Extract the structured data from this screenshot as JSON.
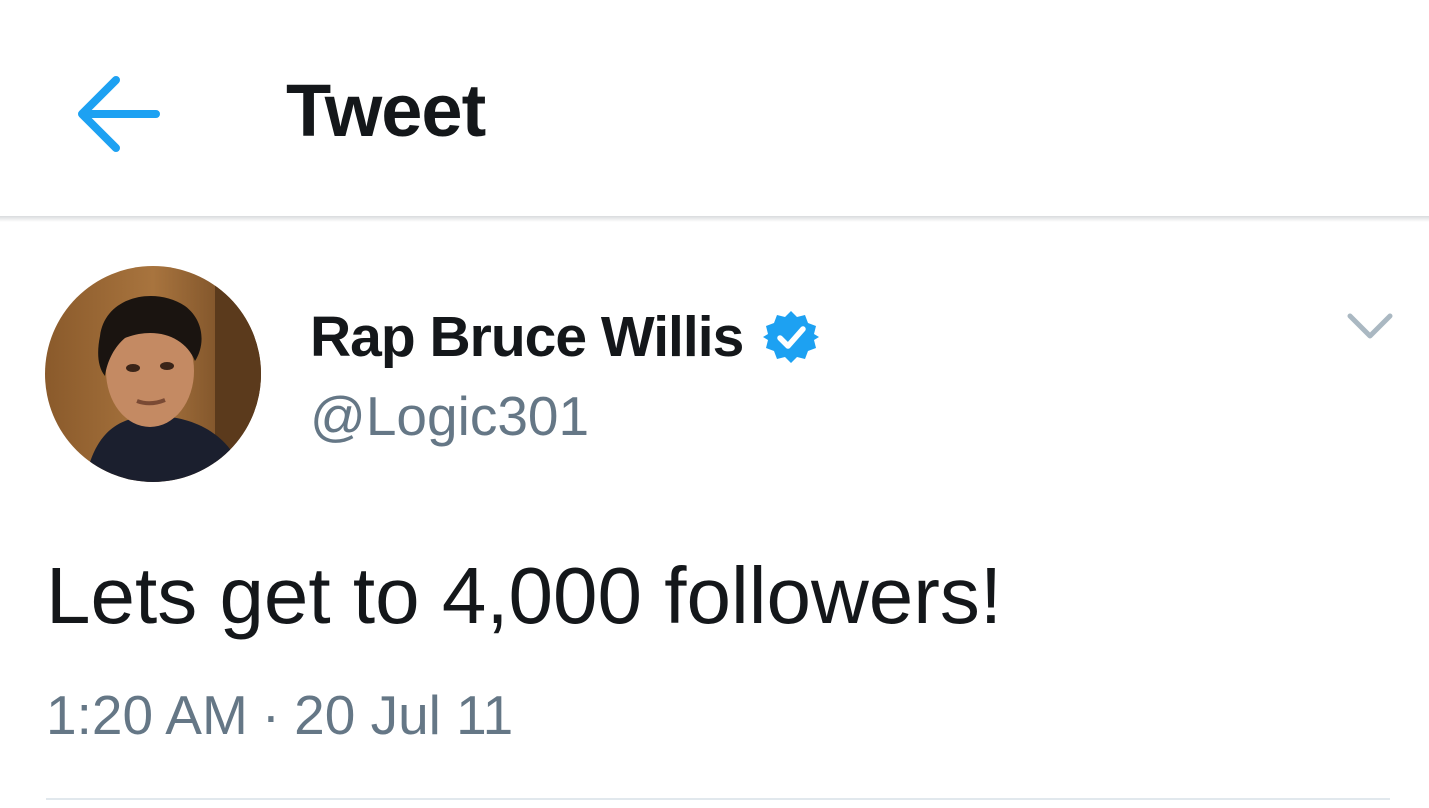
{
  "header": {
    "title": "Tweet",
    "back_icon": "arrow-left-icon"
  },
  "colors": {
    "accent": "#1da1f2",
    "text_primary": "#14171a",
    "text_secondary": "#657786",
    "divider": "#e1e8ed",
    "caret": "#aab8c2"
  },
  "tweet": {
    "author": {
      "display_name": "Rap Bruce Willis",
      "handle": "@Logic301",
      "verified": true,
      "verified_icon": "verified-badge-icon",
      "avatar_icon": "avatar-photo"
    },
    "text": "Lets get to 4,000 followers!",
    "time": "1:20 AM",
    "separator": "·",
    "date": "20 Jul 11",
    "menu_icon": "chevron-down-icon"
  }
}
